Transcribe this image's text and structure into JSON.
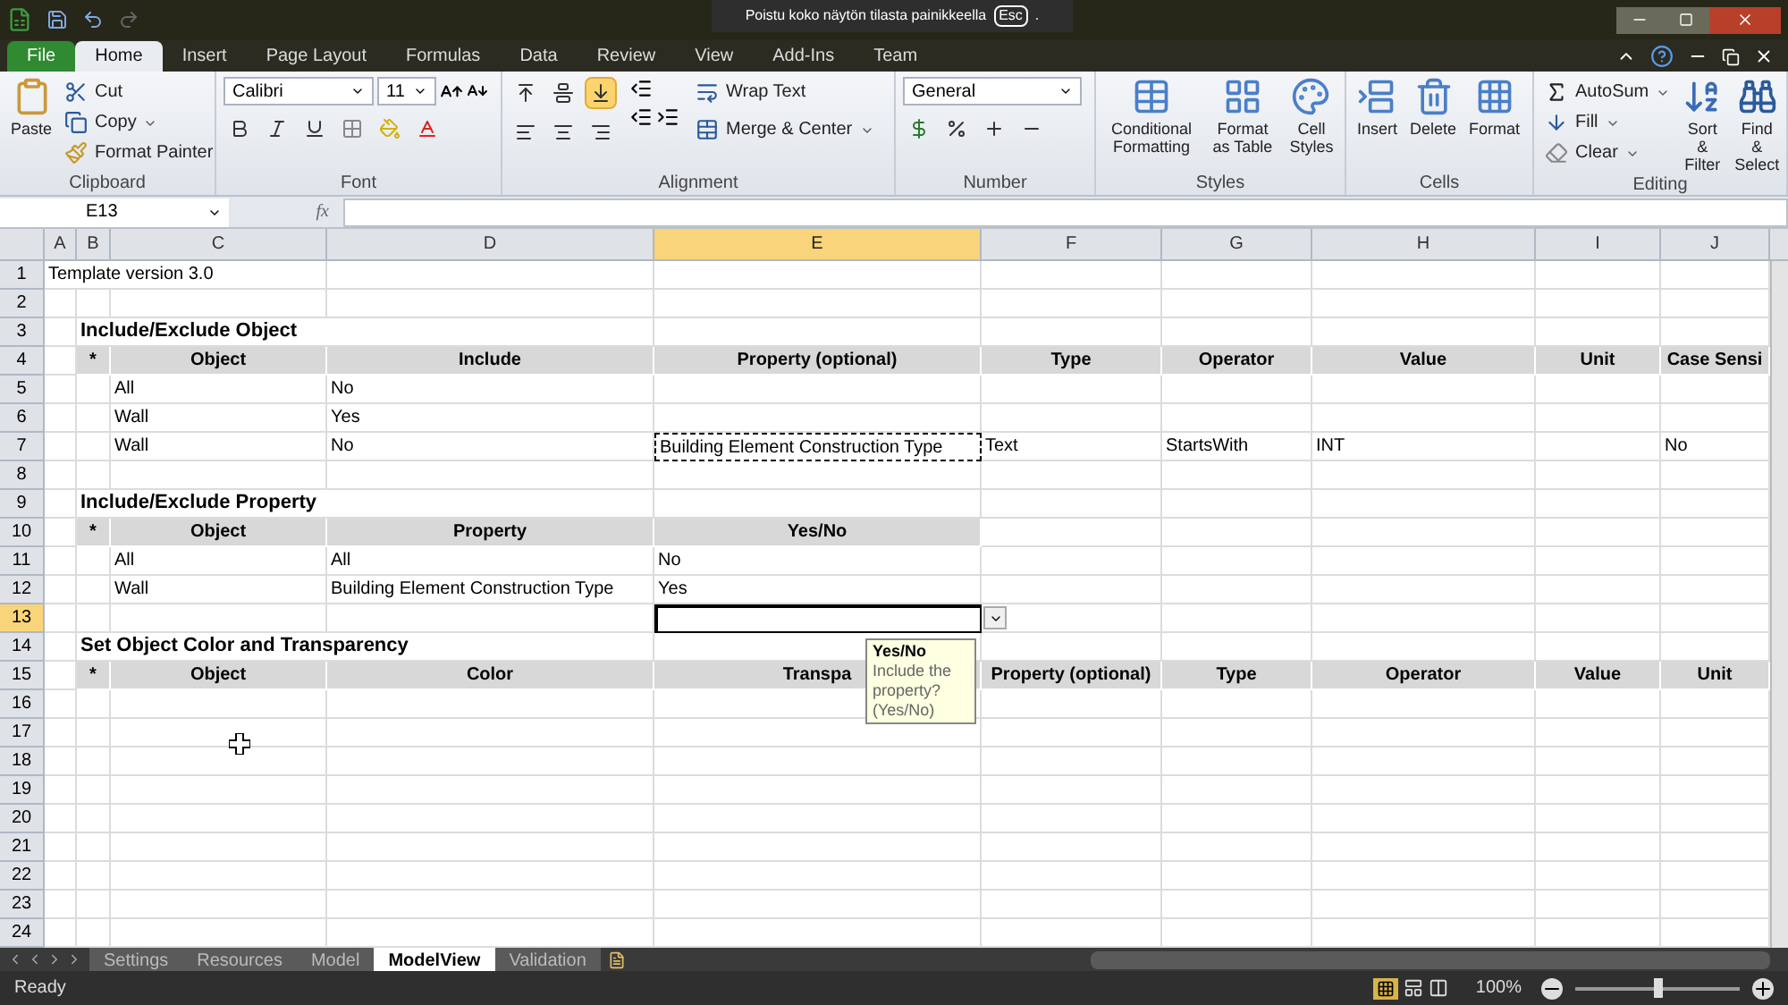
{
  "fullscreen_notice": {
    "text": "Poistu koko näytön tilasta painikkeella",
    "key": "Esc",
    "end": "."
  },
  "tabs": [
    {
      "label": "File",
      "selected": false
    },
    {
      "label": "Home",
      "selected": true
    },
    {
      "label": "Insert",
      "selected": false
    },
    {
      "label": "Page Layout",
      "selected": false
    },
    {
      "label": "Formulas",
      "selected": false
    },
    {
      "label": "Data",
      "selected": false
    },
    {
      "label": "Review",
      "selected": false
    },
    {
      "label": "View",
      "selected": false
    },
    {
      "label": "Add-Ins",
      "selected": false
    },
    {
      "label": "Team",
      "selected": false
    }
  ],
  "ribbon": {
    "clipboard": {
      "label": "Clipboard",
      "paste": "Paste",
      "cut": "Cut",
      "copy": "Copy",
      "format_painter": "Format Painter"
    },
    "font": {
      "label": "Font",
      "name": "Calibri",
      "size": "11"
    },
    "alignment": {
      "label": "Alignment",
      "buttons": [
        {
          "selected": false
        },
        {
          "selected": false
        },
        {
          "selected": true
        },
        {
          "selected": false
        },
        {
          "selected": false
        },
        {
          "selected": false
        }
      ],
      "wrap": "Wrap Text",
      "merge": "Merge & Center"
    },
    "number": {
      "label": "Number",
      "format": "General"
    },
    "styles": {
      "label": "Styles",
      "buttons": [
        "Conditional Formatting",
        "Format as Table",
        "Cell Styles"
      ]
    },
    "cells": {
      "label": "Cells",
      "buttons": [
        "Insert",
        "Delete",
        "Format"
      ]
    },
    "editing": {
      "label": "Editing",
      "autosum": "AutoSum",
      "fill": "Fill",
      "clear": "Clear",
      "sort": "Sort & Filter",
      "find": "Find & Select"
    }
  },
  "name_box": "E13",
  "formula_label": "fx",
  "columns": [
    {
      "label": "A",
      "selected": false
    },
    {
      "label": "B",
      "selected": false
    },
    {
      "label": "C",
      "selected": false
    },
    {
      "label": "D",
      "selected": false
    },
    {
      "label": "E",
      "selected": true
    },
    {
      "label": "F",
      "selected": false
    },
    {
      "label": "G",
      "selected": false
    },
    {
      "label": "H",
      "selected": false
    },
    {
      "label": "I",
      "selected": false
    },
    {
      "label": "J",
      "selected": false
    }
  ],
  "rows": [
    {
      "number": "1",
      "kind": "plain",
      "selected": false,
      "cells": [
        {
          "text": "Template version 3.0",
          "copied": false
        }
      ]
    },
    {
      "number": "2",
      "kind": "plain",
      "selected": false,
      "cells": []
    },
    {
      "number": "3",
      "kind": "section",
      "selected": false,
      "cells": [
        null,
        {
          "text": "Include/Exclude Object",
          "copied": false
        }
      ]
    },
    {
      "number": "4",
      "kind": "header",
      "selected": false,
      "cells": [
        null,
        {
          "text": "*",
          "copied": false
        },
        {
          "text": "Object",
          "copied": false
        },
        {
          "text": "Include",
          "copied": false
        },
        {
          "text": "Property (optional)",
          "copied": false
        },
        {
          "text": "Type",
          "copied": false
        },
        {
          "text": "Operator",
          "copied": false
        },
        {
          "text": "Value",
          "copied": false
        },
        {
          "text": "Unit",
          "copied": false
        },
        {
          "text": "Case Sensi",
          "copied": false
        }
      ]
    },
    {
      "number": "5",
      "kind": "plain",
      "selected": false,
      "cells": [
        null,
        null,
        {
          "text": "All",
          "copied": false
        },
        {
          "text": "No",
          "copied": false
        }
      ]
    },
    {
      "number": "6",
      "kind": "plain",
      "selected": false,
      "cells": [
        null,
        null,
        {
          "text": "Wall",
          "copied": false
        },
        {
          "text": "Yes",
          "copied": false
        }
      ]
    },
    {
      "number": "7",
      "kind": "plain",
      "selected": false,
      "cells": [
        null,
        null,
        {
          "text": "Wall",
          "copied": false
        },
        {
          "text": "No",
          "copied": false
        },
        {
          "text": "Building Element Construction Type",
          "copied": true
        },
        {
          "text": "Text",
          "copied": false
        },
        {
          "text": "StartsWith",
          "copied": false
        },
        {
          "text": "INT",
          "copied": false
        },
        null,
        {
          "text": "No",
          "copied": false
        }
      ]
    },
    {
      "number": "8",
      "kind": "plain",
      "selected": false,
      "cells": []
    },
    {
      "number": "9",
      "kind": "section",
      "selected": false,
      "cells": [
        null,
        {
          "text": "Include/Exclude Property",
          "copied": false
        }
      ]
    },
    {
      "number": "10",
      "kind": "header",
      "selected": false,
      "cells": [
        null,
        {
          "text": "*",
          "copied": false
        },
        {
          "text": "Object",
          "copied": false
        },
        {
          "text": "Property",
          "copied": false
        },
        {
          "text": "Yes/No",
          "copied": false
        }
      ]
    },
    {
      "number": "11",
      "kind": "plain",
      "selected": false,
      "cells": [
        null,
        null,
        {
          "text": "All",
          "copied": false
        },
        {
          "text": "All",
          "copied": false
        },
        {
          "text": "No",
          "copied": false
        }
      ]
    },
    {
      "number": "12",
      "kind": "plain",
      "selected": false,
      "cells": [
        null,
        null,
        {
          "text": "Wall",
          "copied": false
        },
        {
          "text": "Building Element Construction Type",
          "copied": false
        },
        {
          "text": "Yes",
          "copied": false
        }
      ]
    },
    {
      "number": "13",
      "kind": "plain",
      "selected": true,
      "cells": []
    },
    {
      "number": "14",
      "kind": "section",
      "selected": false,
      "cells": [
        null,
        {
          "text": "Set Object Color and Transparency",
          "copied": false
        }
      ]
    },
    {
      "number": "15",
      "kind": "header",
      "selected": false,
      "cells": [
        null,
        {
          "text": "*",
          "copied": false
        },
        {
          "text": "Object",
          "copied": false
        },
        {
          "text": "Color",
          "copied": false
        },
        {
          "text": "Transpa",
          "copied": false
        },
        {
          "text": "Property (optional)",
          "copied": false
        },
        {
          "text": "Type",
          "copied": false
        },
        {
          "text": "Operator",
          "copied": false
        },
        {
          "text": "Value",
          "copied": false
        },
        {
          "text": "Unit",
          "copied": false
        }
      ]
    },
    {
      "number": "16",
      "kind": "plain",
      "selected": false,
      "cells": []
    },
    {
      "number": "17",
      "kind": "plain",
      "selected": false,
      "cells": []
    },
    {
      "number": "18",
      "kind": "plain",
      "selected": false,
      "cells": []
    },
    {
      "number": "19",
      "kind": "plain",
      "selected": false,
      "cells": []
    },
    {
      "number": "20",
      "kind": "plain",
      "selected": false,
      "cells": []
    },
    {
      "number": "21",
      "kind": "plain",
      "selected": false,
      "cells": []
    },
    {
      "number": "22",
      "kind": "plain",
      "selected": false,
      "cells": []
    },
    {
      "number": "23",
      "kind": "plain",
      "selected": false,
      "cells": []
    },
    {
      "number": "24",
      "kind": "plain",
      "selected": false,
      "cells": []
    }
  ],
  "input_message": {
    "title": "Yes/No",
    "text": "Include the property? (Yes/No)"
  },
  "sheets": [
    {
      "label": "Settings",
      "selected": false
    },
    {
      "label": "Resources",
      "selected": false
    },
    {
      "label": "Model",
      "selected": false
    },
    {
      "label": "ModelView",
      "selected": true
    },
    {
      "label": "Validation",
      "selected": false
    }
  ],
  "status": {
    "text": "Ready",
    "zoom": "100%",
    "level": 0.5
  }
}
